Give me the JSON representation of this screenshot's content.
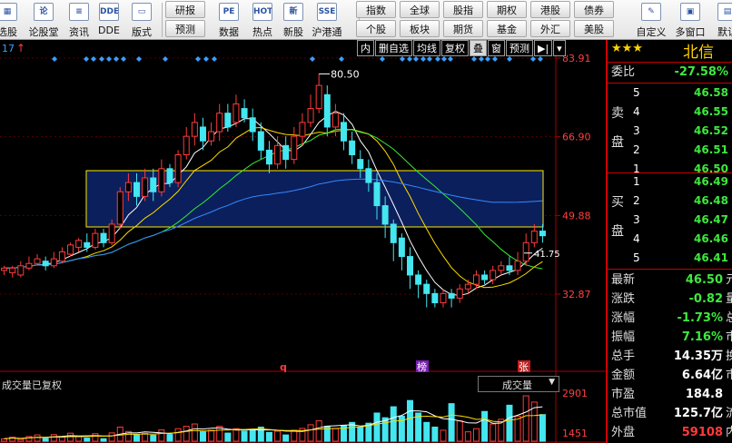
{
  "toolbar": {
    "buttons": [
      {
        "label": "选股",
        "icon": "stock-select-icon",
        "glyph": "▦"
      },
      {
        "label": "论股堂",
        "icon": "forum-icon",
        "glyph": "论"
      },
      {
        "label": "资讯",
        "icon": "news-icon",
        "glyph": "≡"
      },
      {
        "label": "DDE",
        "icon": "dde-icon",
        "glyph": "DDE"
      },
      {
        "label": "版式",
        "icon": "layout-icon",
        "glyph": "▭"
      },
      {
        "label": "数据",
        "icon": "data-icon",
        "glyph": "PE"
      },
      {
        "label": "热点",
        "icon": "hot-spot-icon",
        "glyph": "HOT"
      },
      {
        "label": "新股",
        "icon": "new-stock-icon",
        "glyph": "新"
      },
      {
        "label": "沪港通",
        "icon": "sh-hk-connect-icon",
        "glyph": "SSE"
      },
      {
        "label": "自定义",
        "icon": "customize-icon",
        "glyph": "✎"
      },
      {
        "label": "多窗口",
        "icon": "multi-window-icon",
        "glyph": "▣"
      },
      {
        "label": "默认",
        "icon": "default-icon",
        "glyph": "▤"
      }
    ],
    "grid_left": [
      [
        "研报",
        "预测"
      ]
    ],
    "grid_right": [
      [
        "指数",
        "全球",
        "股指",
        "期权",
        "港股",
        "债券"
      ],
      [
        "个股",
        "板块",
        "期货",
        "基金",
        "外汇",
        "美股"
      ]
    ]
  },
  "chart": {
    "top_left_text": "17",
    "toolbar": [
      "内",
      "删自选",
      "均线",
      "复权",
      "叠",
      "窗",
      "预测"
    ],
    "nav_glyph": "▶|",
    "price_ticks": [
      "83.91",
      "66.90",
      "49.88",
      "32.87"
    ],
    "high_label": "80.50",
    "current_label": "41.75",
    "markers": [
      "q",
      "榜",
      "张"
    ],
    "volume_title": "成交量已复权",
    "volume_selector": "成交量",
    "volume_ticks": [
      "2901",
      "1451"
    ]
  },
  "chart_data": {
    "type": "candlestick",
    "y_ticks": [
      83.91,
      66.9,
      49.88,
      32.87
    ],
    "ylim": [
      18,
      86
    ],
    "volume_ticks": [
      2901,
      1451
    ],
    "max_price": 80.5,
    "last_price": 41.75,
    "candles": [
      [
        38,
        38.5,
        37,
        39
      ],
      [
        37.5,
        38.5,
        36.5,
        39
      ],
      [
        37,
        39,
        36.5,
        40
      ],
      [
        38.5,
        39.5,
        38,
        41
      ],
      [
        39.5,
        40.5,
        39,
        41.5
      ],
      [
        40,
        39,
        38,
        41
      ],
      [
        39,
        40.5,
        38.5,
        42
      ],
      [
        40,
        42,
        39.5,
        43
      ],
      [
        41.5,
        43.5,
        41,
        44
      ],
      [
        43,
        44.5,
        42,
        45
      ],
      [
        44,
        43,
        42,
        46
      ],
      [
        43,
        46,
        42.5,
        47
      ],
      [
        46,
        44,
        43,
        47
      ],
      [
        44,
        48,
        43.5,
        49
      ],
      [
        48,
        55,
        47,
        56
      ],
      [
        55,
        57,
        53,
        59
      ],
      [
        57,
        54,
        52,
        59
      ],
      [
        54,
        58,
        53,
        60
      ],
      [
        58,
        55,
        53,
        60
      ],
      [
        55,
        60,
        54,
        62
      ],
      [
        60,
        57,
        56,
        61
      ],
      [
        57,
        63,
        56,
        64
      ],
      [
        63,
        67,
        62,
        69
      ],
      [
        67,
        70,
        65,
        72
      ],
      [
        69,
        66,
        64,
        71
      ],
      [
        66,
        68,
        65,
        70
      ],
      [
        68,
        72,
        66,
        74
      ],
      [
        72,
        69,
        68,
        74
      ],
      [
        70,
        74,
        69,
        76
      ],
      [
        73,
        71,
        70,
        75
      ],
      [
        71,
        68,
        66,
        73
      ],
      [
        68,
        64,
        62,
        70
      ],
      [
        64,
        61,
        59,
        66
      ],
      [
        61,
        65,
        60,
        67
      ],
      [
        65,
        62,
        60,
        67
      ],
      [
        62,
        67,
        61,
        69
      ],
      [
        67,
        70,
        65,
        72
      ],
      [
        70,
        73,
        69,
        76
      ],
      [
        73,
        78,
        72,
        80.5
      ],
      [
        76,
        69,
        67,
        78
      ],
      [
        69,
        72,
        67,
        74
      ],
      [
        70,
        66,
        64,
        72
      ],
      [
        66,
        63,
        61,
        68
      ],
      [
        62,
        60,
        58,
        64
      ],
      [
        60,
        57,
        55,
        62
      ],
      [
        57,
        52,
        49,
        59
      ],
      [
        52,
        48,
        45,
        54
      ],
      [
        48,
        44,
        40,
        49
      ],
      [
        45,
        41,
        38,
        46
      ],
      [
        41,
        37,
        34,
        43
      ],
      [
        37,
        35,
        32,
        38
      ],
      [
        35,
        33,
        30,
        36
      ],
      [
        33,
        31,
        30,
        34
      ],
      [
        31,
        33,
        30,
        34
      ],
      [
        33,
        32,
        30,
        34
      ],
      [
        32,
        34,
        31,
        35
      ],
      [
        34,
        35,
        33,
        36
      ],
      [
        35,
        37,
        34,
        38
      ],
      [
        37,
        36,
        35,
        38
      ],
      [
        36,
        38,
        35,
        39
      ],
      [
        38,
        39,
        37,
        40
      ],
      [
        39,
        38,
        37,
        41
      ],
      [
        38,
        40,
        37,
        42
      ],
      [
        40,
        44,
        39,
        46
      ],
      [
        44,
        46.5,
        43,
        48
      ],
      [
        46.5,
        45.5,
        44,
        48
      ]
    ],
    "volumes": [
      150,
      260,
      120,
      300,
      400,
      180,
      420,
      250,
      510,
      320,
      200,
      480,
      160,
      530,
      900,
      620,
      420,
      500,
      380,
      720,
      430,
      800,
      950,
      1100,
      600,
      700,
      950,
      520,
      800,
      650,
      720,
      900,
      560,
      640,
      400,
      700,
      820,
      1050,
      1300,
      950,
      800,
      1000,
      1200,
      900,
      1150,
      1800,
      1500,
      2200,
      1600,
      2600,
      1800,
      1200,
      900,
      700,
      2400,
      1300,
      600,
      800,
      1900,
      1100,
      1400,
      2300,
      1600,
      2900,
      2500,
      1700
    ]
  },
  "panel": {
    "stars": "★★★",
    "stock_name": "北信",
    "weibi_label": "委比",
    "weibi_value": "-27.58%",
    "sell_label": [
      "卖",
      "盘"
    ],
    "buy_label": [
      "买",
      "盘"
    ],
    "asks": [
      {
        "level": "5",
        "price": "46.58"
      },
      {
        "level": "4",
        "price": "46.55"
      },
      {
        "level": "3",
        "price": "46.52"
      },
      {
        "level": "2",
        "price": "46.51"
      },
      {
        "level": "1",
        "price": "46.50"
      }
    ],
    "bids": [
      {
        "level": "1",
        "price": "46.49"
      },
      {
        "level": "2",
        "price": "46.48"
      },
      {
        "level": "3",
        "price": "46.47"
      },
      {
        "level": "4",
        "price": "46.46"
      },
      {
        "level": "5",
        "price": "46.41"
      }
    ],
    "stats": [
      {
        "label": "最新",
        "value": "46.50",
        "suffix": "元",
        "color": "#3ee83e"
      },
      {
        "label": "涨跌",
        "value": "-0.82",
        "suffix": "量",
        "color": "#3ee83e"
      },
      {
        "label": "涨幅",
        "value": "-1.73%",
        "suffix": "总",
        "color": "#3ee83e"
      },
      {
        "label": "振幅",
        "value": "7.16%",
        "suffix": "市",
        "color": "#3ee83e"
      },
      {
        "label": "总手",
        "value": "14.35万",
        "suffix": "换",
        "color": "#ffffff"
      },
      {
        "label": "金额",
        "value": "6.64亿",
        "suffix": "市",
        "color": "#ffffff"
      },
      {
        "label": "市盈",
        "value": "184.8",
        "suffix": "",
        "color": "#ffffff"
      },
      {
        "label": "总市值",
        "value": "125.7亿",
        "suffix": "流",
        "color": "#ffffff"
      },
      {
        "label": "外盘",
        "value": "59108",
        "suffix": "内",
        "color": "#ff3b3b"
      }
    ]
  },
  "colors": {
    "up": "#ff3b3b",
    "down": "#44e6f0",
    "ma_white": "#ffffff",
    "ma_yellow": "#ffdc00",
    "ma_green": "#33ee33",
    "ma_blue": "#3388ff",
    "selection_fill": "#0b1f5c",
    "selection_border": "#ffea00"
  }
}
